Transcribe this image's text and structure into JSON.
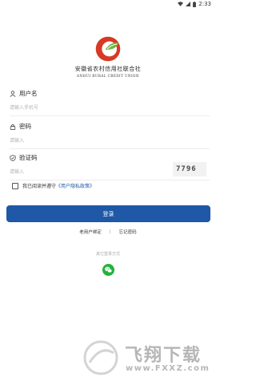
{
  "status_bar": {
    "time": "2:33"
  },
  "org": {
    "name_cn": "安徽省农村信用社联合社",
    "name_en": "ANHUI RURAL CREDIT UNION"
  },
  "fields": {
    "username": {
      "label": "用户名",
      "placeholder": "请输入手机号"
    },
    "password": {
      "label": "密码",
      "placeholder": "请输入"
    },
    "captcha": {
      "label": "验证码",
      "placeholder": "请输入",
      "code": "7796"
    }
  },
  "agreement": {
    "text": "我已阅读并遵守",
    "link": "《用户隐私政策》"
  },
  "login_button": "登录",
  "links": {
    "bind_old_user": "老用户绑定",
    "separator": "|",
    "forgot_password": "忘记密码"
  },
  "other_login": "其它登录方式",
  "watermark": {
    "cn": "飞翔下载",
    "en": "www.FXXZ.com"
  },
  "colors": {
    "primary": "#1e58a6",
    "wechat": "#23b33c",
    "logo_red": "#d63a26",
    "logo_green": "#6fb43f"
  }
}
